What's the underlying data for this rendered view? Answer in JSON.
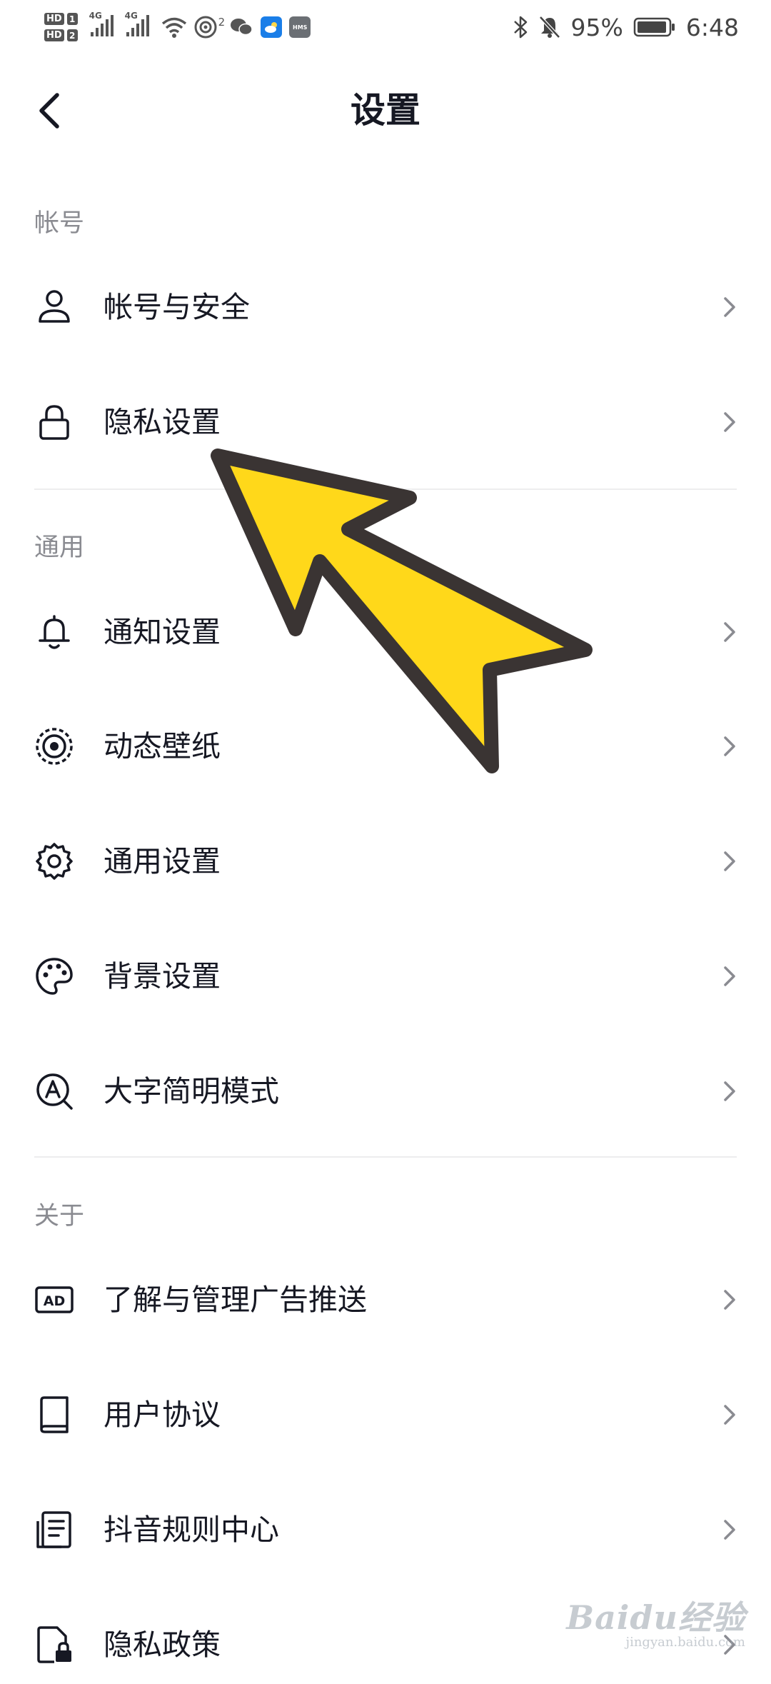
{
  "status_bar": {
    "hd1": "HD",
    "sim1": "1",
    "hd2": "HD",
    "sim2": "2",
    "net1": "4G",
    "net2": "4G",
    "hotspot_count": "2",
    "app_hms": "HMS",
    "battery": "95%",
    "time": "6:48"
  },
  "header": {
    "back_icon": "chevron-left-icon",
    "title": "设置"
  },
  "sections": {
    "account": {
      "title": "帐号",
      "items": [
        {
          "label": "帐号与安全",
          "icon": "user-icon"
        },
        {
          "label": "隐私设置",
          "icon": "lock-icon"
        }
      ]
    },
    "general": {
      "title": "通用",
      "items": [
        {
          "label": "通知设置",
          "icon": "bell-icon"
        },
        {
          "label": "动态壁纸",
          "icon": "live-wallpaper-icon"
        },
        {
          "label": "通用设置",
          "icon": "gear-icon"
        },
        {
          "label": "背景设置",
          "icon": "palette-icon"
        },
        {
          "label": "大字简明模式",
          "icon": "large-text-icon"
        }
      ]
    },
    "about": {
      "title": "关于",
      "items": [
        {
          "label": "了解与管理广告推送",
          "icon": "ad-icon"
        },
        {
          "label": "用户协议",
          "icon": "book-icon"
        },
        {
          "label": "抖音规则中心",
          "icon": "rules-document-icon"
        },
        {
          "label": "隐私政策",
          "icon": "privacy-document-icon"
        }
      ]
    }
  },
  "colors": {
    "text_primary": "#161823",
    "text_secondary": "#8a8b91",
    "divider": "#ededee",
    "chevron": "#8a8b91",
    "arrow_fill": "#ffd81a",
    "arrow_stroke": "#3a3433"
  },
  "watermark": {
    "main": "Baidu经验",
    "sub": "jingyan.baidu.com"
  }
}
